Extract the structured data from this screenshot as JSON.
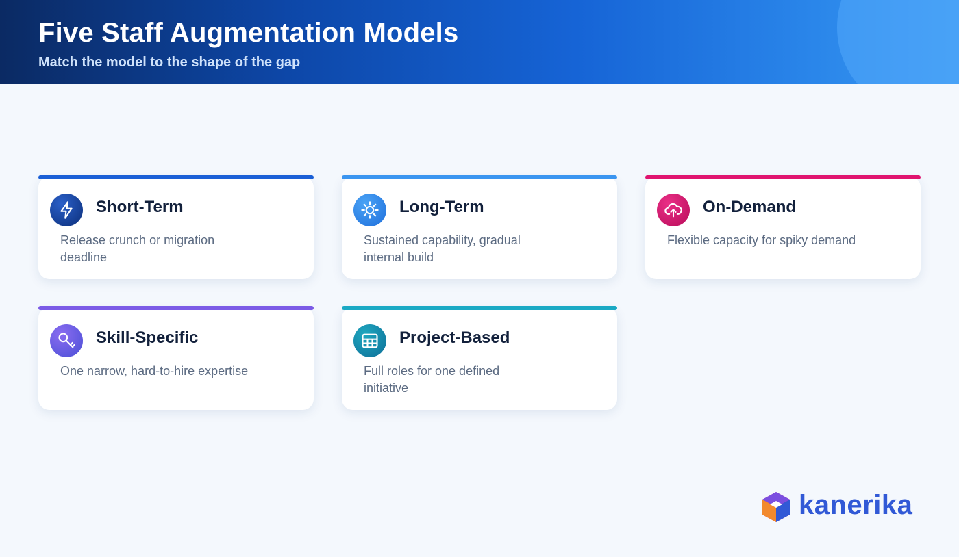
{
  "header": {
    "title": "Five Staff Augmentation Models",
    "subtitle": "Match the model to the shape of the gap"
  },
  "cards": [
    {
      "title": "Short-Term",
      "description": "Release crunch or migration deadline",
      "icon": "lightning-icon",
      "accent": "#1a5fd6"
    },
    {
      "title": "Long-Term",
      "description": "Sustained capability, gradual internal build",
      "icon": "sun-icon",
      "accent": "#3a95f0"
    },
    {
      "title": "On-Demand",
      "description": "Flexible capacity for spiky demand",
      "icon": "cloud-upload-icon",
      "accent": "#e0146f"
    },
    {
      "title": "Skill-Specific",
      "description": "One narrow, hard-to-hire expertise",
      "icon": "key-icon",
      "accent": "#7b5be6"
    },
    {
      "title": "Project-Based",
      "description": "Full roles for one defined initiative",
      "icon": "grid-icon",
      "accent": "#1aa9c4"
    }
  ],
  "logo": {
    "text": "kanerika"
  }
}
